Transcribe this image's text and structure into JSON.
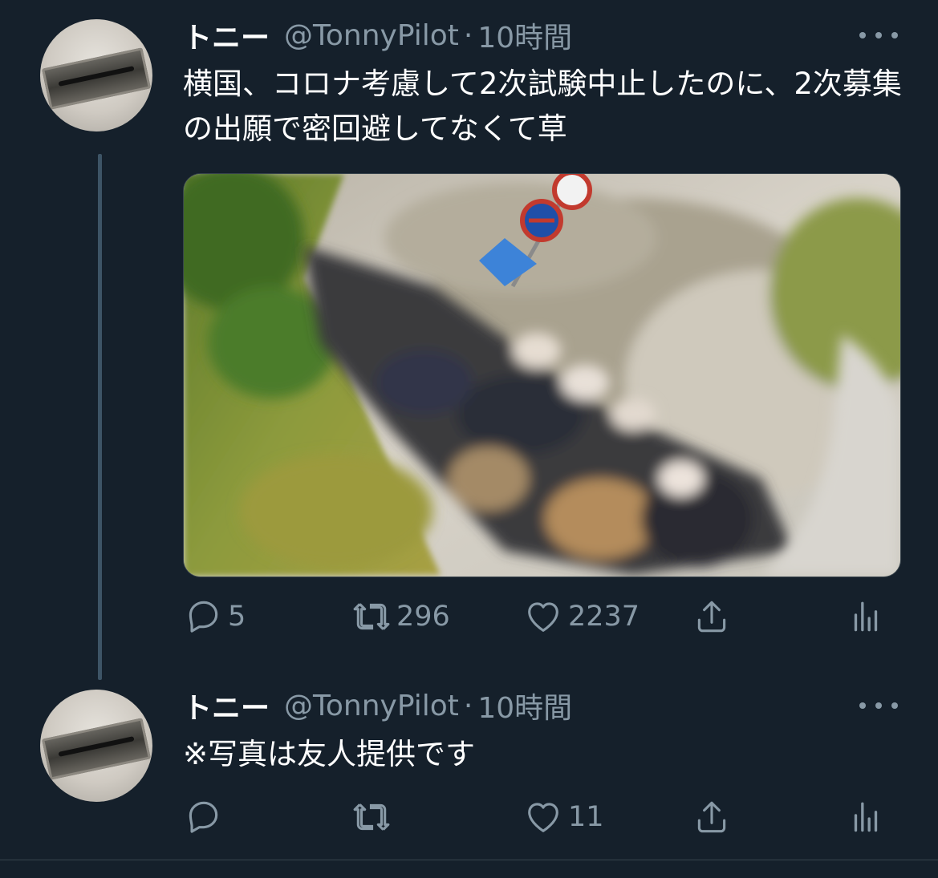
{
  "tweets": [
    {
      "display_name": "トニー",
      "handle": "@TonnyPilot",
      "separator": "·",
      "time": "10時間",
      "text": "横国、コロナ考慮して2次試験中止したのに、2次募集の出願で密回避してなくて草",
      "has_media": true,
      "replies": "5",
      "retweets": "296",
      "likes": "2237"
    },
    {
      "display_name": "トニー",
      "handle": "@TonnyPilot",
      "separator": "·",
      "time": "10時間",
      "text": "※写真は友人提供です",
      "has_media": false,
      "replies": "",
      "retweets": "",
      "likes": "11"
    }
  ],
  "icons": {
    "reply": "speech-bubble-icon",
    "retweet": "retweet-arrows-icon",
    "like": "heart-icon",
    "share": "share-upload-icon",
    "analytics": "bar-chart-icon",
    "more": "more-dots-icon"
  },
  "colors": {
    "background": "#15202b",
    "text": "#ffffff",
    "secondary": "#8899a6",
    "thread_line": "#3d5466"
  }
}
